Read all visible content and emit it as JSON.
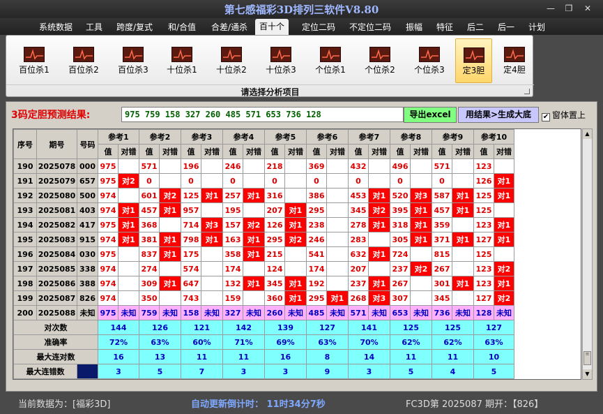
{
  "window": {
    "title": "第七感福彩3D排列三软件V8.80",
    "controls": [
      "minimize-icon",
      "restore-icon",
      "close-icon"
    ]
  },
  "menu": [
    "系统数据",
    "工具",
    "跨度/复式",
    "和/合值",
    "合差/通杀",
    "百十个",
    "定位二码",
    "不定位二码",
    "振幅",
    "特征",
    "后二",
    "后一",
    "计划"
  ],
  "menu_active": 5,
  "ribbon": {
    "buttons": [
      "百位杀1",
      "百位杀2",
      "百位杀3",
      "十位杀1",
      "十位杀2",
      "十位杀3",
      "个位杀1",
      "个位杀2",
      "个位杀3",
      "定3胆",
      "定4胆"
    ],
    "selected": 9,
    "caption": "请选择分析项目"
  },
  "prediction": {
    "label": "3码定胆预测结果:",
    "value": "975 759 158 327 260 485 571 653 736 128",
    "excel_button": "导出excel",
    "generate_button": "用结果>生成大底",
    "topmost_label": "窗体置上",
    "topmost_checked": true
  },
  "table": {
    "header_fixed": [
      "序号",
      "期号",
      "号码"
    ],
    "groups": [
      "参考1",
      "参考2",
      "参考3",
      "参考4",
      "参考5",
      "参考6",
      "参考7",
      "参考8",
      "参考9",
      "参考10"
    ],
    "sub": [
      "值",
      "对错"
    ],
    "rows": [
      {
        "n": "190",
        "period": "2025078",
        "code": "000",
        "cells": [
          [
            "975",
            ""
          ],
          [
            "571",
            ""
          ],
          [
            "196",
            ""
          ],
          [
            "246",
            ""
          ],
          [
            "218",
            ""
          ],
          [
            "369",
            ""
          ],
          [
            "432",
            ""
          ],
          [
            "496",
            ""
          ],
          [
            "571",
            ""
          ],
          [
            "123",
            ""
          ]
        ]
      },
      {
        "n": "191",
        "period": "2025079",
        "code": "657",
        "cells": [
          [
            "975",
            "对2"
          ],
          [
            "0",
            ""
          ],
          [
            "0",
            ""
          ],
          [
            "0",
            ""
          ],
          [
            "0",
            ""
          ],
          [
            "0",
            ""
          ],
          [
            "0",
            ""
          ],
          [
            "0",
            ""
          ],
          [
            "0",
            ""
          ],
          [
            "126",
            "对1"
          ]
        ]
      },
      {
        "n": "192",
        "period": "2025080",
        "code": "500",
        "cells": [
          [
            "974",
            ""
          ],
          [
            "601",
            "对2"
          ],
          [
            "125",
            "对1"
          ],
          [
            "257",
            "对1"
          ],
          [
            "316",
            ""
          ],
          [
            "386",
            ""
          ],
          [
            "453",
            "对1"
          ],
          [
            "520",
            "对3"
          ],
          [
            "587",
            "对1"
          ],
          [
            "125",
            "对1"
          ]
        ]
      },
      {
        "n": "193",
        "period": "2025081",
        "code": "403",
        "cells": [
          [
            "974",
            "对1"
          ],
          [
            "457",
            "对1"
          ],
          [
            "957",
            ""
          ],
          [
            "195",
            ""
          ],
          [
            "207",
            "对1"
          ],
          [
            "295",
            ""
          ],
          [
            "345",
            "对2"
          ],
          [
            "395",
            "对1"
          ],
          [
            "457",
            "对1"
          ],
          [
            "125",
            ""
          ]
        ]
      },
      {
        "n": "194",
        "period": "2025082",
        "code": "417",
        "cells": [
          [
            "975",
            "对1"
          ],
          [
            "368",
            ""
          ],
          [
            "714",
            "对3"
          ],
          [
            "157",
            "对2"
          ],
          [
            "126",
            "对1"
          ],
          [
            "238",
            ""
          ],
          [
            "278",
            "对1"
          ],
          [
            "318",
            "对1"
          ],
          [
            "359",
            ""
          ],
          [
            "123",
            "对1"
          ]
        ]
      },
      {
        "n": "195",
        "period": "2025083",
        "code": "915",
        "cells": [
          [
            "974",
            "对1"
          ],
          [
            "381",
            "对1"
          ],
          [
            "798",
            "对1"
          ],
          [
            "163",
            "对1"
          ],
          [
            "295",
            "对2"
          ],
          [
            "246",
            ""
          ],
          [
            "283",
            ""
          ],
          [
            "305",
            "对1"
          ],
          [
            "371",
            "对1"
          ],
          [
            "127",
            "对1"
          ]
        ]
      },
      {
        "n": "196",
        "period": "2025084",
        "code": "030",
        "cells": [
          [
            "975",
            ""
          ],
          [
            "837",
            "对1"
          ],
          [
            "175",
            ""
          ],
          [
            "358",
            "对1"
          ],
          [
            "215",
            ""
          ],
          [
            "541",
            ""
          ],
          [
            "632",
            "对1"
          ],
          [
            "724",
            ""
          ],
          [
            "815",
            ""
          ],
          [
            "125",
            ""
          ]
        ]
      },
      {
        "n": "197",
        "period": "2025085",
        "code": "338",
        "cells": [
          [
            "974",
            ""
          ],
          [
            "274",
            ""
          ],
          [
            "574",
            ""
          ],
          [
            "174",
            ""
          ],
          [
            "124",
            ""
          ],
          [
            "174",
            ""
          ],
          [
            "207",
            ""
          ],
          [
            "237",
            "对2"
          ],
          [
            "267",
            ""
          ],
          [
            "123",
            "对2"
          ]
        ]
      },
      {
        "n": "198",
        "period": "2025086",
        "code": "388",
        "cells": [
          [
            "974",
            ""
          ],
          [
            "309",
            "对1"
          ],
          [
            "647",
            ""
          ],
          [
            "132",
            "对1"
          ],
          [
            "345",
            "对1"
          ],
          [
            "192",
            ""
          ],
          [
            "237",
            "对1"
          ],
          [
            "267",
            ""
          ],
          [
            "301",
            "对1"
          ],
          [
            "123",
            "对1"
          ]
        ]
      },
      {
        "n": "199",
        "period": "2025087",
        "code": "826",
        "cells": [
          [
            "974",
            ""
          ],
          [
            "350",
            ""
          ],
          [
            "743",
            ""
          ],
          [
            "159",
            ""
          ],
          [
            "360",
            "对1"
          ],
          [
            "295",
            "对1"
          ],
          [
            "268",
            "对3"
          ],
          [
            "307",
            ""
          ],
          [
            "345",
            ""
          ],
          [
            "127",
            "对2"
          ]
        ]
      }
    ],
    "pred_row": {
      "n": "200",
      "period": "2025088",
      "code": "未知",
      "cells": [
        [
          "975",
          "未知"
        ],
        [
          "759",
          "未知"
        ],
        [
          "158",
          "未知"
        ],
        [
          "327",
          "未知"
        ],
        [
          "260",
          "未知"
        ],
        [
          "485",
          "未知"
        ],
        [
          "571",
          "未知"
        ],
        [
          "653",
          "未知"
        ],
        [
          "736",
          "未知"
        ],
        [
          "128",
          "未知"
        ]
      ]
    },
    "stats": [
      {
        "label": "对次数",
        "values": [
          "144",
          "126",
          "121",
          "142",
          "139",
          "127",
          "141",
          "125",
          "125",
          "127"
        ]
      },
      {
        "label": "准确率",
        "values": [
          "72%",
          "63%",
          "60%",
          "71%",
          "69%",
          "63%",
          "70%",
          "62%",
          "62%",
          "63%"
        ]
      },
      {
        "label": "最大连对数",
        "values": [
          "16",
          "13",
          "11",
          "11",
          "16",
          "8",
          "14",
          "11",
          "11",
          "10"
        ]
      },
      {
        "label": "最大连错数",
        "values": [
          "3",
          "5",
          "7",
          "3",
          "3",
          "9",
          "3",
          "5",
          "4",
          "5"
        ]
      }
    ]
  },
  "status": {
    "source": "当前数据为：[福彩3D]",
    "countdown": "自动更新倒计时： 11时34分7秒",
    "issue": "FC3D第 2025087 期开：【826】"
  },
  "colors": {
    "hit": "#ff0000",
    "pred": "#ffb0ff",
    "stats": "#80ffff",
    "value": "#e00000",
    "blue": "#0000c0"
  }
}
